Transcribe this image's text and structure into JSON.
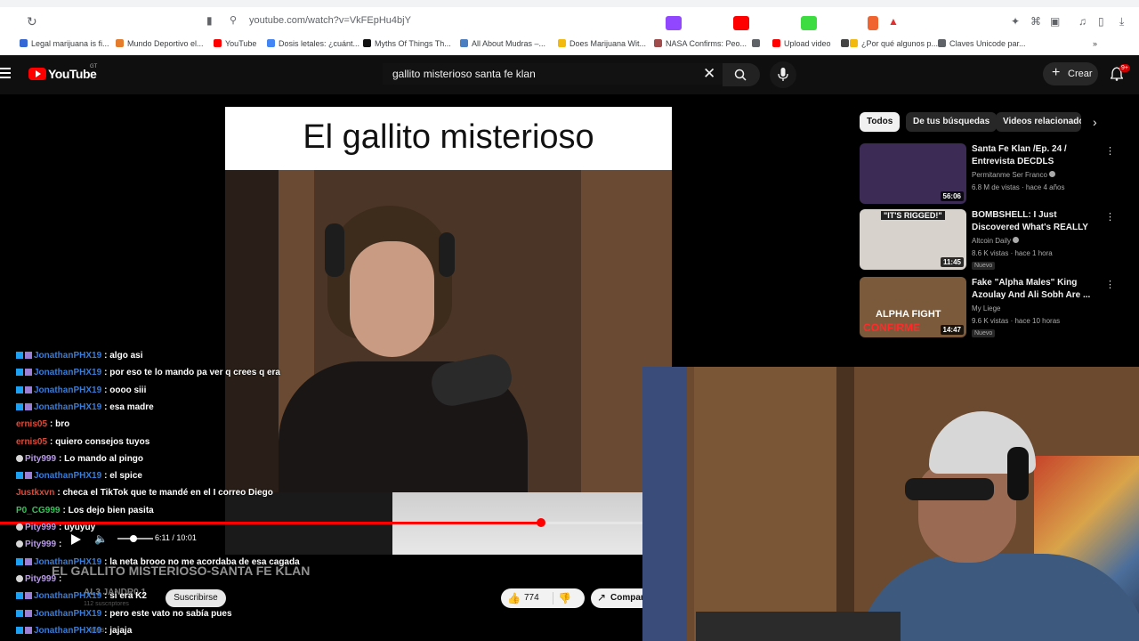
{
  "browser": {
    "url": "youtube.com/watch?v=VkFEpHu4bjY",
    "bookmarks": [
      {
        "label": "Legal marijuana is fi...",
        "color": "#3367d6"
      },
      {
        "label": "Mundo Deportivo el...",
        "color": "#e57c2b"
      },
      {
        "label": "YouTube",
        "color": "#ff0000"
      },
      {
        "label": "Dosis letales: ¿cuánt...",
        "color": "#4285f4"
      },
      {
        "label": "Myths Of Things Th...",
        "color": "#111111"
      },
      {
        "label": "All About Mudras –...",
        "color": "#4a7fc1"
      },
      {
        "label": "Does Marijuana Wit...",
        "color": "#f2b90f"
      },
      {
        "label": "NASA Confirms: Peo...",
        "color": "#a04c4c"
      },
      {
        "label": "",
        "color": "#5f6368"
      },
      {
        "label": "Upload video",
        "color": "#ff0000"
      },
      {
        "label": "",
        "color": "#444444"
      },
      {
        "label": "¿Por qué algunos p...",
        "color": "#f2b90f"
      },
      {
        "label": "Claves Unicode par...",
        "color": "#5f6368"
      }
    ]
  },
  "youtube": {
    "wordmark": "YouTube",
    "region": "GT",
    "search_query": "gallito misterioso santa fe klan",
    "create_label": "Crear",
    "notifications_badge": "9+"
  },
  "video": {
    "title_card": "El gallito misterioso",
    "current_time": "6:11 / 10:01",
    "progress": 0.617,
    "heading": "EL GALLITO MISTERIOSO-SANTA FE KLAN",
    "channel": "AL3 JANDR0 1",
    "subscribers": "112 suscriptores",
    "subscribe_label": "Suscribirse",
    "likes": "774",
    "share_label": "Compartir",
    "description_ghost": "años"
  },
  "chat": [
    {
      "badge": "blue",
      "user": "JonathanPHX19",
      "color": "#3a7bd5",
      "msg": ": algo asi"
    },
    {
      "badge": "blue",
      "user": "JonathanPHX19",
      "color": "#3a7bd5",
      "msg": ": por eso te lo mando pa ver q crees q era"
    },
    {
      "badge": "blue",
      "user": "JonathanPHX19",
      "color": "#3a7bd5",
      "msg": ": oooo siii"
    },
    {
      "badge": "blue",
      "user": "JonathanPHX19",
      "color": "#3a7bd5",
      "msg": ": esa madre"
    },
    {
      "badge": "",
      "user": "ernis05",
      "color": "#d84b3a",
      "msg": ": bro"
    },
    {
      "badge": "",
      "user": "ernis05",
      "color": "#d84b3a",
      "msg": ": quiero consejos tuyos"
    },
    {
      "badge": "shield",
      "user": "Pity999",
      "color": "#b99be8",
      "msg": ": Lo mando al pingo"
    },
    {
      "badge": "blue",
      "user": "JonathanPHX19",
      "color": "#3a7bd5",
      "msg": ": el spice"
    },
    {
      "badge": "",
      "user": "Justkxvn",
      "color": "#d84b3a",
      "msg": ": checa el TikTok que te mandé en el I correo Diego"
    },
    {
      "badge": "",
      "user": "P0_CG999",
      "color": "#39c05a",
      "msg": ": Los dejo bien pasita"
    },
    {
      "badge": "shield",
      "user": "Pity999",
      "color": "#b99be8",
      "msg": ": uyuyuy"
    },
    {
      "badge": "shield",
      "user": "Pity999",
      "color": "#b99be8",
      "msg": ":"
    },
    {
      "badge": "blue",
      "user": "JonathanPHX19",
      "color": "#3a7bd5",
      "msg": ": la neta brooo no me acordaba de esa cagada"
    },
    {
      "badge": "shield",
      "user": "Pity999",
      "color": "#b99be8",
      "msg": ":"
    },
    {
      "badge": "blue",
      "user": "JonathanPHX19",
      "color": "#3a7bd5",
      "msg": ": si era K2"
    },
    {
      "badge": "blue",
      "user": "JonathanPHX19",
      "color": "#3a7bd5",
      "msg": ": pero este vato no sabía pues"
    },
    {
      "badge": "blue",
      "user": "JonathanPHX19",
      "color": "#3a7bd5",
      "msg": ": jajaja"
    }
  ],
  "sidebar": {
    "chips": [
      "Todos",
      "De tus búsquedas",
      "Videos relacionados"
    ],
    "recommendations": [
      {
        "title": "Santa Fe Klan /Ep. 24 / Entrevista DECDLS",
        "channel": "Permitanme Ser Franco",
        "verified": true,
        "stats": "6.8 M de vistas · hace 4 años",
        "duration": "56:06",
        "new": "",
        "thumb_color": "#3b2b55"
      },
      {
        "title": "BOMBSHELL: I Just Discovered What's REALLY Going On with ...",
        "channel": "Altcoin Daily",
        "verified": true,
        "stats": "8.6 K vistas · hace 1 hora",
        "duration": "11:45",
        "new": "Nuevo",
        "thumb_color": "#d8d2cc"
      },
      {
        "title": "Fake \"Alpha Males\" King Azoulay And Ali Sobh Are ...",
        "channel": "My Liege",
        "verified": false,
        "stats": "9.6 K vistas · hace 10 horas",
        "duration": "14:47",
        "new": "Nuevo",
        "thumb_color": "#7a5a3a"
      }
    ]
  },
  "thumb_text": {
    "rigged": "\"IT'S RIGGED!\"",
    "alpha": "ALPHA FIGHT",
    "confirme": "CONFIRME"
  }
}
